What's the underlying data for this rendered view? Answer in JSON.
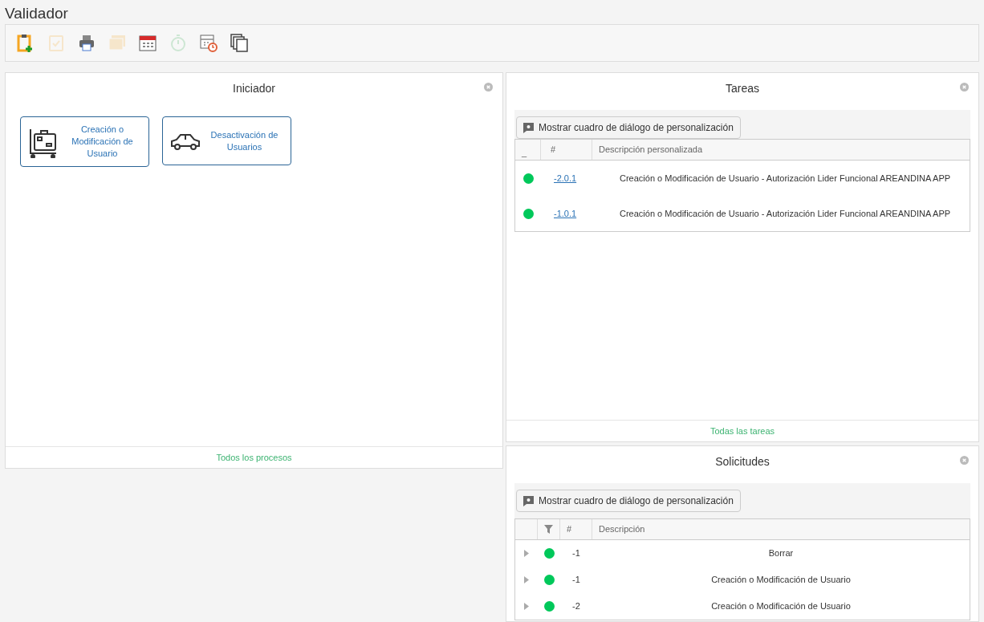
{
  "window": {
    "title": "Validador"
  },
  "toolbar": [
    {
      "kind": "clipboard-add",
      "disabled": false
    },
    {
      "kind": "clipboard-check",
      "disabled": true
    },
    {
      "kind": "printer",
      "disabled": false
    },
    {
      "kind": "folders",
      "disabled": true
    },
    {
      "kind": "calendar",
      "disabled": false
    },
    {
      "kind": "stopwatch",
      "disabled": true
    },
    {
      "kind": "calendar-clock",
      "disabled": false
    },
    {
      "kind": "copy",
      "disabled": false
    }
  ],
  "iniciador": {
    "title": "Iniciador",
    "processes": [
      {
        "kind": "cart",
        "label": "Creación o Modificación de Usuario"
      },
      {
        "kind": "car",
        "label": "Desactivación de Usuarios"
      }
    ],
    "footer_link": "Todos los procesos"
  },
  "tareas": {
    "title": "Tareas",
    "customize_button": "Mostrar cuadro de diálogo de personalización",
    "columns": [
      "_",
      "#",
      "Descripción personalizada"
    ],
    "rows": [
      {
        "number": "-2.0.1",
        "description": "Creación o Modificación de Usuario - Autorización Lider Funcional AREANDINA APP"
      },
      {
        "number": "-1.0.1",
        "description": "Creación o Modificación de Usuario - Autorización Lider Funcional AREANDINA APP"
      }
    ],
    "footer_link": "Todas las tareas"
  },
  "solicitudes": {
    "title": "Solicitudes",
    "customize_button": "Mostrar cuadro de diálogo de personalización",
    "columns": [
      "#",
      "Descripción"
    ],
    "rows": [
      {
        "expanded": false,
        "number": "-1",
        "description": "Borrar"
      },
      {
        "expanded": false,
        "number": "-1",
        "description": "Creación o Modificación de Usuario"
      },
      {
        "expanded": false,
        "number": "-2",
        "description": "Creación o Modificación de Usuario"
      }
    ]
  }
}
